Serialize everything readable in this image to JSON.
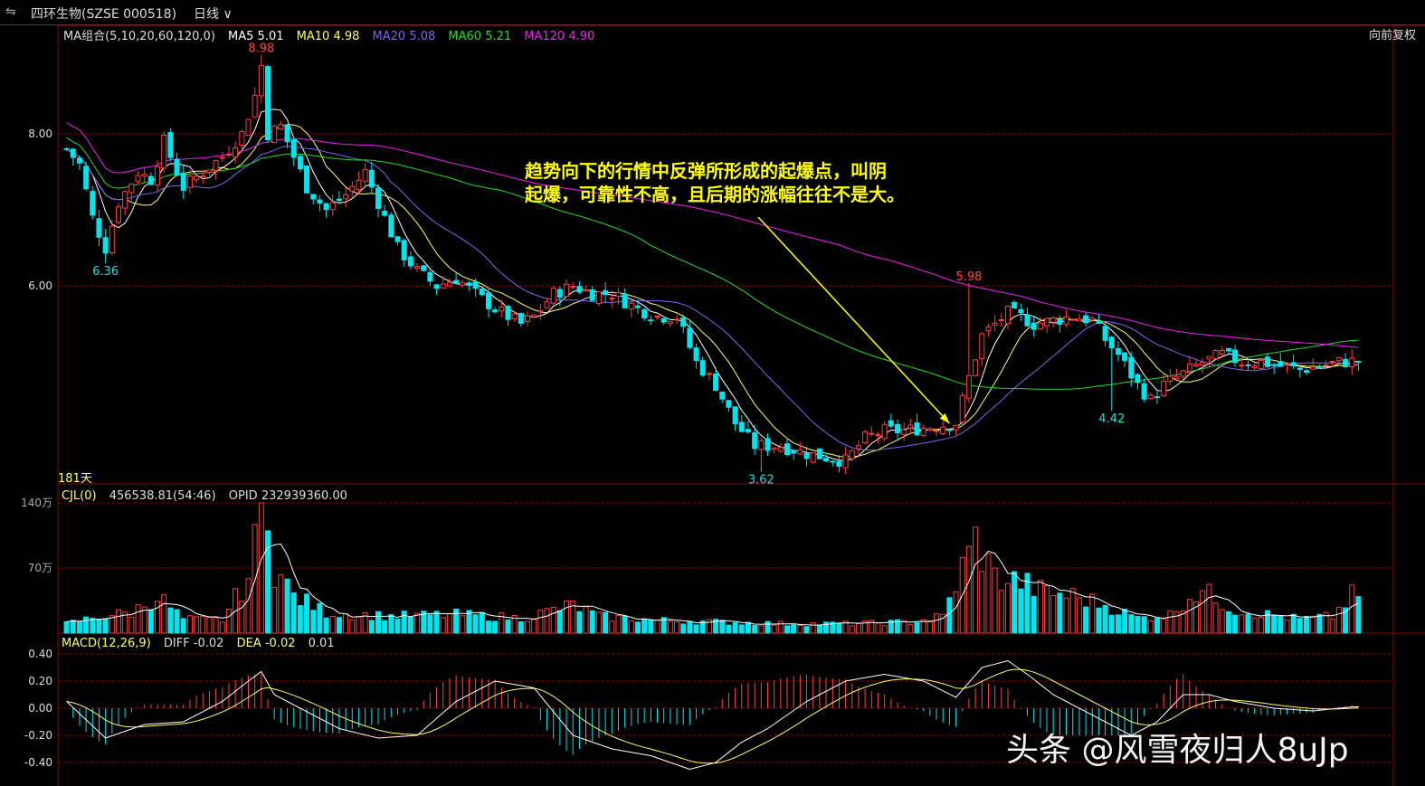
{
  "header": {
    "back_icon": "chevron-left-right-icon",
    "stock_name": "四环生物(SZSE 000518)",
    "period": "日线",
    "adjust": "向前复权"
  },
  "ma_legend": {
    "combo": "MA组合(5,10,20,60,120,0)",
    "items": [
      {
        "label": "MA5 5.01",
        "color": "#ffffff"
      },
      {
        "label": "MA10 4.98",
        "color": "#ffff66"
      },
      {
        "label": "MA20 5.08",
        "color": "#7b68ee"
      },
      {
        "label": "MA60 5.21",
        "color": "#22dd22"
      },
      {
        "label": "MA120 4.90",
        "color": "#ee22ee"
      }
    ]
  },
  "vol_legend": {
    "name": "CJL(0)",
    "value": "456538.81(54:46)",
    "opid": "OPID 232939360.00"
  },
  "macd_legend": {
    "name": "MACD(12,26,9)",
    "diff": "DIFF -0.02",
    "dea": "DEA -0.02",
    "macd": "0.01"
  },
  "annotation": {
    "line1": "趋势向下的行情中反弹所形成的起爆点，叫阴",
    "line2": "起爆，可靠性不高，且后期的涨幅往往不是大。"
  },
  "watermark": "头条 @风雪夜归人8uJp",
  "chart_data": {
    "type": "candlestick",
    "days_label": "181天",
    "price_axis": {
      "ticks": [
        "8.00",
        "6.00"
      ],
      "ylim": [
        3.4,
        9.2
      ]
    },
    "volume_axis": {
      "ticks": [
        "140万",
        "70万"
      ],
      "ylim": [
        0,
        140
      ]
    },
    "macd_axis": {
      "ticks": [
        "0.40",
        "0.20",
        "0.00",
        "-0.20",
        "-0.40"
      ],
      "ylim": [
        -0.48,
        0.42
      ]
    },
    "labels": [
      {
        "text": "8.98",
        "color": "#ff4444",
        "index": 30
      },
      {
        "text": "6.36",
        "color": "#22dddd",
        "index": 6
      },
      {
        "text": "3.62",
        "color": "#22dddd",
        "index": 107
      },
      {
        "text": "5.98",
        "color": "#ff4444",
        "index": 139
      },
      {
        "text": "4.42",
        "color": "#22dddd",
        "index": 161
      }
    ],
    "anchors": [
      [
        0,
        7.8
      ],
      [
        2,
        7.6
      ],
      [
        4,
        6.9
      ],
      [
        6,
        6.5
      ],
      [
        8,
        7.1
      ],
      [
        11,
        7.5
      ],
      [
        13,
        7.4
      ],
      [
        15,
        7.9
      ],
      [
        18,
        7.3
      ],
      [
        21,
        7.5
      ],
      [
        24,
        7.7
      ],
      [
        27,
        8.0
      ],
      [
        29,
        8.5
      ],
      [
        30,
        8.9
      ],
      [
        31,
        8.0
      ],
      [
        33,
        8.1
      ],
      [
        35,
        7.7
      ],
      [
        37,
        7.3
      ],
      [
        40,
        7.0
      ],
      [
        43,
        7.2
      ],
      [
        46,
        7.5
      ],
      [
        48,
        7.1
      ],
      [
        51,
        6.5
      ],
      [
        54,
        6.2
      ],
      [
        57,
        6.0
      ],
      [
        60,
        6.1
      ],
      [
        63,
        5.9
      ],
      [
        66,
        5.7
      ],
      [
        70,
        5.5
      ],
      [
        72,
        5.6
      ],
      [
        75,
        5.9
      ],
      [
        78,
        6.0
      ],
      [
        81,
        5.9
      ],
      [
        84,
        5.9
      ],
      [
        88,
        5.7
      ],
      [
        91,
        5.6
      ],
      [
        94,
        5.6
      ],
      [
        97,
        5.0
      ],
      [
        100,
        4.7
      ],
      [
        103,
        4.2
      ],
      [
        106,
        3.9
      ],
      [
        110,
        3.9
      ],
      [
        114,
        3.8
      ],
      [
        117,
        3.75
      ],
      [
        120,
        3.7
      ],
      [
        123,
        4.0
      ],
      [
        126,
        4.1
      ],
      [
        129,
        4.1
      ],
      [
        133,
        4.15
      ],
      [
        137,
        4.2
      ],
      [
        139,
        4.8
      ],
      [
        141,
        5.35
      ],
      [
        143,
        5.5
      ],
      [
        145,
        5.65
      ],
      [
        147,
        5.6
      ],
      [
        149,
        5.5
      ],
      [
        152,
        5.55
      ],
      [
        155,
        5.6
      ],
      [
        158,
        5.55
      ],
      [
        160,
        5.3
      ],
      [
        162,
        5.1
      ],
      [
        165,
        4.7
      ],
      [
        167,
        4.5
      ],
      [
        169,
        4.7
      ],
      [
        172,
        4.85
      ],
      [
        175,
        5.0
      ],
      [
        178,
        5.1
      ],
      [
        181,
        5.0
      ],
      [
        184,
        5.0
      ],
      [
        187,
        4.95
      ],
      [
        190,
        4.9
      ],
      [
        193,
        4.95
      ],
      [
        196,
        5.0
      ],
      [
        198,
        5.01
      ]
    ],
    "volume_profile": [
      [
        0,
        10
      ],
      [
        5,
        18
      ],
      [
        10,
        22
      ],
      [
        14,
        40
      ],
      [
        18,
        15
      ],
      [
        24,
        14
      ],
      [
        28,
        60
      ],
      [
        30,
        126
      ],
      [
        32,
        70
      ],
      [
        35,
        40
      ],
      [
        40,
        22
      ],
      [
        50,
        18
      ],
      [
        60,
        20
      ],
      [
        70,
        16
      ],
      [
        78,
        30
      ],
      [
        82,
        18
      ],
      [
        90,
        14
      ],
      [
        100,
        12
      ],
      [
        110,
        10
      ],
      [
        120,
        10
      ],
      [
        130,
        12
      ],
      [
        135,
        18
      ],
      [
        138,
        70
      ],
      [
        140,
        100
      ],
      [
        143,
        60
      ],
      [
        147,
        55
      ],
      [
        150,
        45
      ],
      [
        155,
        40
      ],
      [
        160,
        30
      ],
      [
        165,
        16
      ],
      [
        170,
        20
      ],
      [
        173,
        40
      ],
      [
        175,
        45
      ],
      [
        180,
        25
      ],
      [
        185,
        20
      ],
      [
        190,
        15
      ],
      [
        195,
        18
      ],
      [
        198,
        40
      ]
    ],
    "macd_profile": [
      [
        0,
        0.05
      ],
      [
        6,
        -0.22
      ],
      [
        12,
        -0.12
      ],
      [
        18,
        -0.1
      ],
      [
        24,
        0.05
      ],
      [
        28,
        0.2
      ],
      [
        30,
        0.27
      ],
      [
        32,
        0.1
      ],
      [
        36,
        0.0
      ],
      [
        42,
        -0.15
      ],
      [
        48,
        -0.22
      ],
      [
        54,
        -0.2
      ],
      [
        60,
        0.05
      ],
      [
        66,
        0.2
      ],
      [
        72,
        0.15
      ],
      [
        78,
        -0.2
      ],
      [
        84,
        -0.3
      ],
      [
        90,
        -0.35
      ],
      [
        96,
        -0.45
      ],
      [
        100,
        -0.4
      ],
      [
        104,
        -0.25
      ],
      [
        108,
        -0.15
      ],
      [
        114,
        0.05
      ],
      [
        120,
        0.2
      ],
      [
        126,
        0.25
      ],
      [
        132,
        0.2
      ],
      [
        137,
        0.08
      ],
      [
        141,
        0.3
      ],
      [
        145,
        0.35
      ],
      [
        148,
        0.25
      ],
      [
        152,
        0.1
      ],
      [
        156,
        0.0
      ],
      [
        160,
        -0.1
      ],
      [
        164,
        -0.2
      ],
      [
        168,
        -0.1
      ],
      [
        172,
        0.1
      ],
      [
        176,
        0.1
      ],
      [
        180,
        0.05
      ],
      [
        186,
        0.0
      ],
      [
        192,
        -0.02
      ],
      [
        198,
        0.01
      ]
    ]
  }
}
